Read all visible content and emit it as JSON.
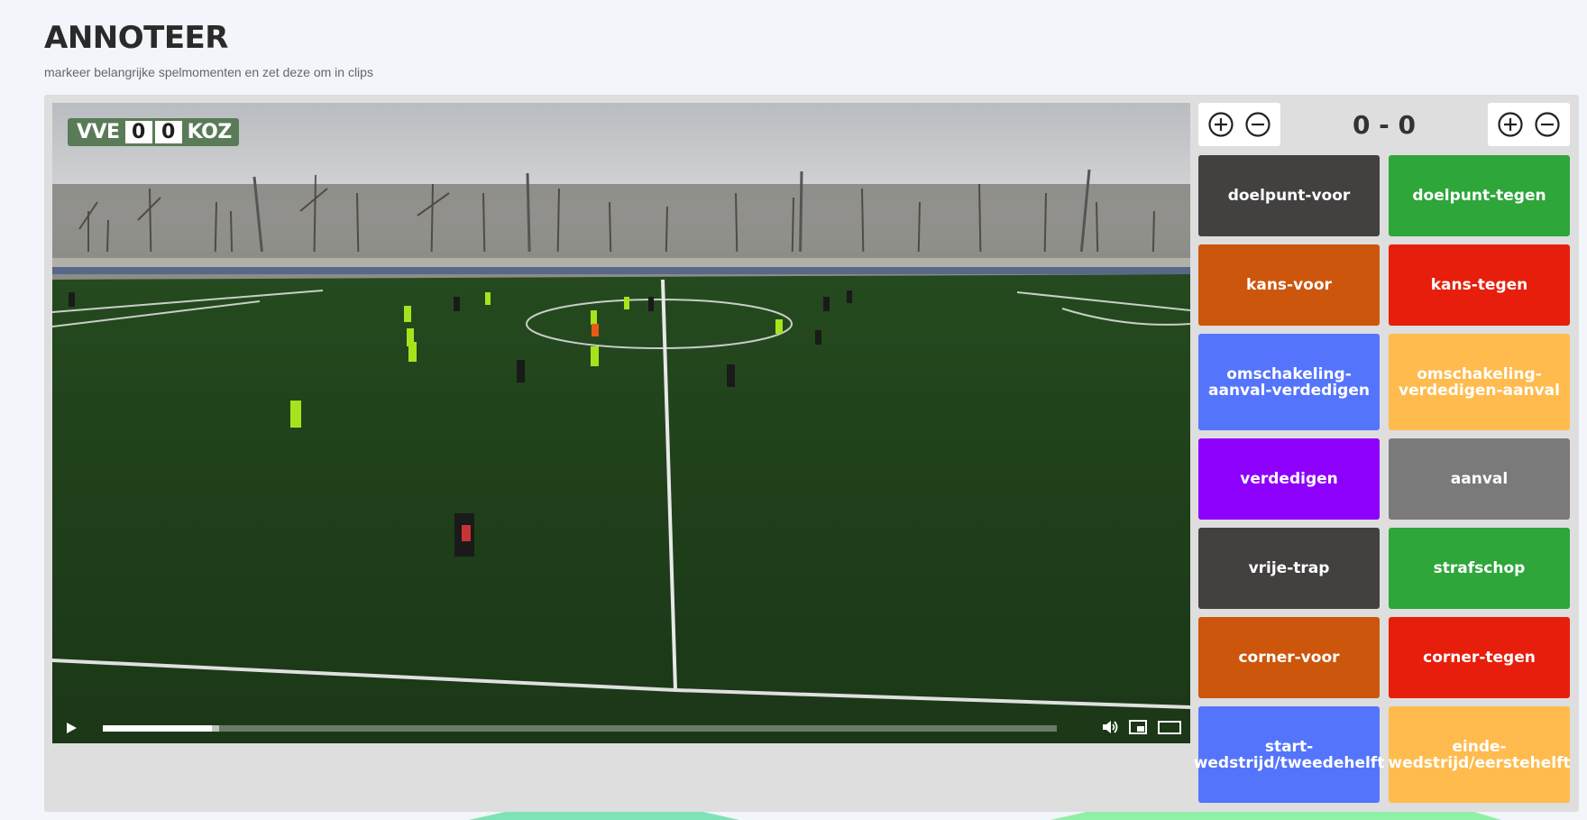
{
  "header": {
    "title": "ANNOTEER",
    "subtitle": "markeer belangrijke spelmomenten en zet deze om in clips"
  },
  "video": {
    "scorebug": {
      "home": "VVE",
      "home_score": "0",
      "away_score": "0",
      "away": "KOZ"
    },
    "progress": {
      "played_fraction": 0.114,
      "buffered_fraction": 0.122
    },
    "icons": [
      "play-icon",
      "volume-icon",
      "picture-in-picture-icon",
      "fullscreen-icon"
    ]
  },
  "score": {
    "display": "0 - 0",
    "home_controls": [
      "plus-circle-icon",
      "minus-circle-icon"
    ],
    "away_controls": [
      "plus-circle-icon",
      "minus-circle-icon"
    ]
  },
  "tags": [
    {
      "label": "doelpunt-voor",
      "color": "#434040"
    },
    {
      "label": "doelpunt-tegen",
      "color": "#2ea63a"
    },
    {
      "label": "kans-voor",
      "color": "#cc560c"
    },
    {
      "label": "kans-tegen",
      "color": "#e71e0c"
    },
    {
      "label": "omschakeling-aanval-verdedigen",
      "color": "#5475fb"
    },
    {
      "label": "omschakeling-verdedigen-aanval",
      "color": "#ffbb4d"
    },
    {
      "label": "verdedigen",
      "color": "#8d00fb"
    },
    {
      "label": "aanval",
      "color": "#7b7a7b"
    },
    {
      "label": "vrije-trap",
      "color": "#434040"
    },
    {
      "label": "strafschop",
      "color": "#2ea63a"
    },
    {
      "label": "corner-voor",
      "color": "#cc560c"
    },
    {
      "label": "corner-tegen",
      "color": "#e71e0c"
    },
    {
      "label": "start-wedstrijd/tweedehelft",
      "color": "#5475fb"
    },
    {
      "label": "einde-wedstrijd/eerstehelft",
      "color": "#ffbb4d"
    }
  ]
}
